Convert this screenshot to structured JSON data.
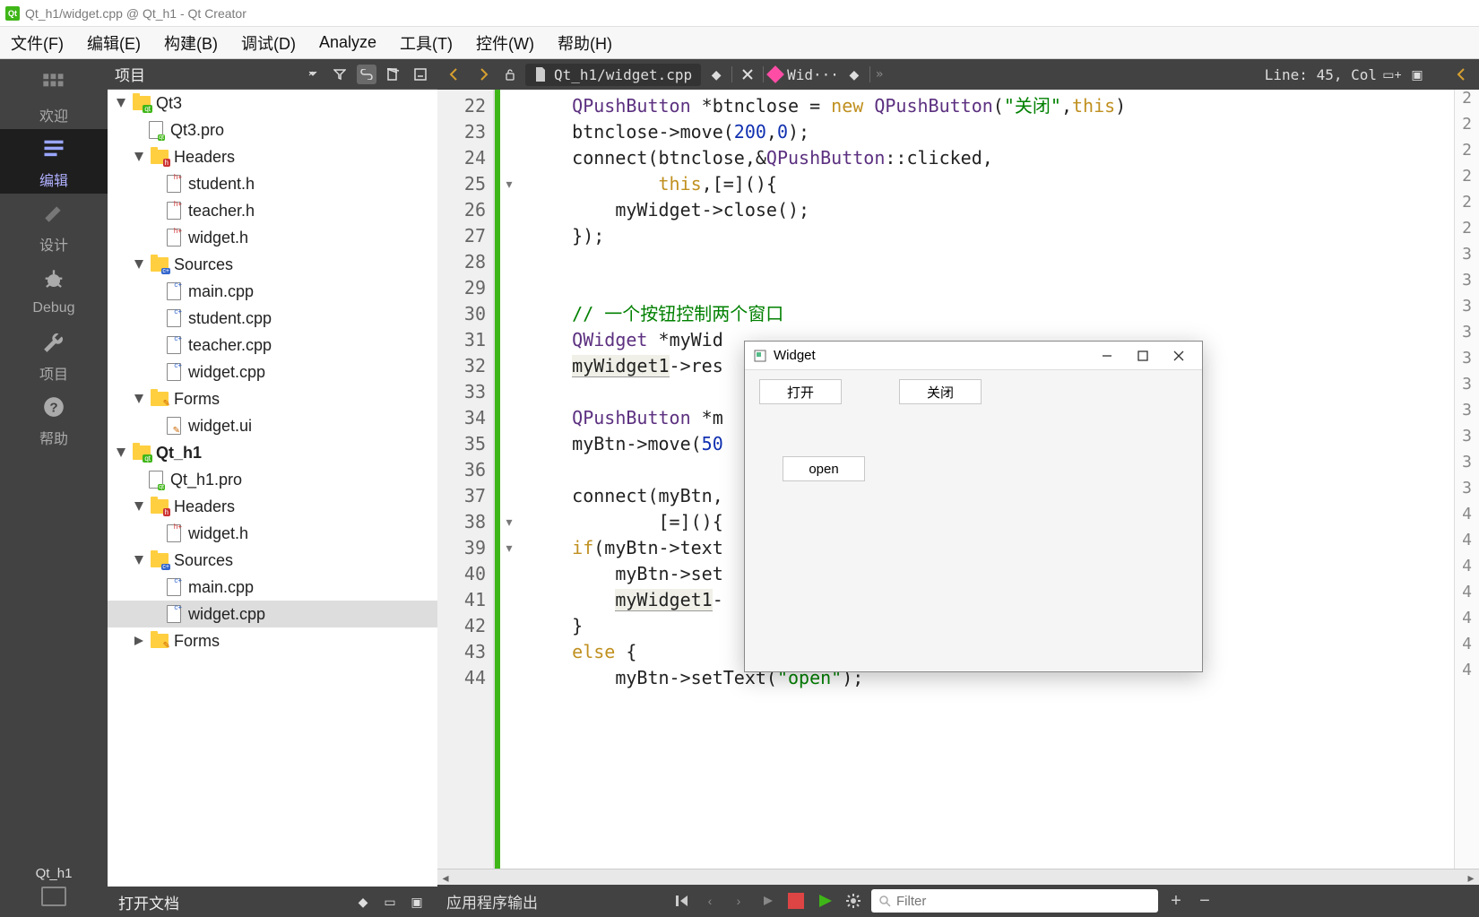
{
  "titlebar": {
    "title": "Qt_h1/widget.cpp @ Qt_h1 - Qt Creator"
  },
  "menu": {
    "file": "文件(F)",
    "edit": "编辑(E)",
    "build": "构建(B)",
    "debug": "调试(D)",
    "analyze": "Analyze",
    "tools": "工具(T)",
    "widgets": "控件(W)",
    "help": "帮助(H)"
  },
  "leftbar": {
    "welcome": "欢迎",
    "edit": "编辑",
    "design": "设计",
    "debug": "Debug",
    "project": "项目",
    "help": "帮助",
    "kit": "Qt_h1"
  },
  "panel": {
    "project": "项目"
  },
  "tree": {
    "qt3": "Qt3",
    "qt3pro": "Qt3.pro",
    "headers": "Headers",
    "studenth": "student.h",
    "teacherh": "teacher.h",
    "widgeth": "widget.h",
    "sources": "Sources",
    "maincpp": "main.cpp",
    "studentcpp": "student.cpp",
    "teachercpp": "teacher.cpp",
    "widgetcpp": "widget.cpp",
    "forms": "Forms",
    "widgetui": "widget.ui",
    "qth1": "Qt_h1",
    "qth1pro": "Qt_h1.pro"
  },
  "docs": {
    "title": "打开文档"
  },
  "editor": {
    "file": "Qt_h1/widget.cpp",
    "symbol": "Wid···",
    "pos": "Line: 45, Col",
    "lines": [
      "22",
      "23",
      "24",
      "25",
      "26",
      "27",
      "28",
      "29",
      "30",
      "31",
      "32",
      "33",
      "34",
      "35",
      "36",
      "37",
      "38",
      "39",
      "40",
      "41",
      "42",
      "43",
      "44"
    ],
    "mini": [
      "2",
      "2",
      "2",
      "2",
      "2",
      "2",
      "3",
      "3",
      "3",
      "3",
      "3",
      "3",
      "3",
      "3",
      "3",
      "3",
      "4",
      "4",
      "4",
      "4",
      "4",
      "4",
      "4"
    ]
  },
  "code": {
    "l22a": "QPushButton",
    "l22b": "btnclose",
    "l22c": "new",
    "l22d": "QPushButton",
    "l22e": "\"关闭\"",
    "l22f": "this",
    "l23a": "btnclose->move(",
    "l23b": "200",
    "l23c": ",",
    "l23d": "0",
    "l23e": ");",
    "l24a": "connect(btnclose,&",
    "l24b": "QPushButton",
    "l24c": "::clicked,",
    "l25a": "this",
    "l25b": ",[=](){",
    "l26a": "myWidget->close();",
    "l27a": "});",
    "l30a": "// 一个按钮控制两个窗口",
    "l31a": "QWidget",
    "l31b": "myWid",
    "l32a": "myWidget1",
    "l32b": "->res",
    "l34a": "QPushButton",
    "l34b": "m",
    "l35a": "myBtn->move(",
    "l35b": "50",
    "l37a": "connect(myBtn,",
    "l38a": "[=](){",
    "l39a": "if",
    "l39b": "(myBtn->text",
    "l40a": "myBtn->set",
    "l41a": "myWidget1",
    "l42a": "}",
    "l43a": "else",
    "l43b": " {",
    "l44a": "myBtn->setText(",
    "l44b": "\"open\"",
    "l44c": ");"
  },
  "bottom": {
    "output": "应用程序输出",
    "filter": "Filter"
  },
  "child": {
    "title": "Widget",
    "open": "打开",
    "close": "关闭",
    "openBtn": "open"
  }
}
